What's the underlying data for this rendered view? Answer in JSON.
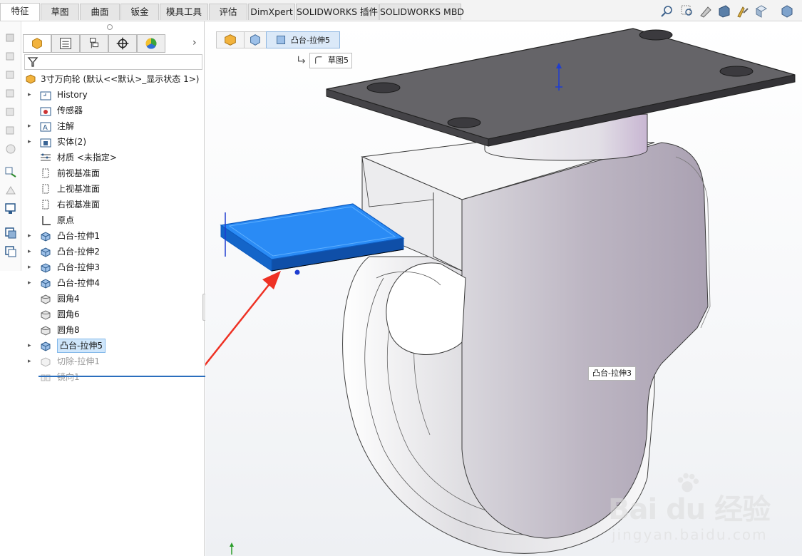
{
  "tabs": [
    {
      "label": "特征",
      "active": true
    },
    {
      "label": "草图"
    },
    {
      "label": "曲面"
    },
    {
      "label": "钣金"
    },
    {
      "label": "模具工具"
    },
    {
      "label": "评估"
    },
    {
      "label": "DimXpert"
    },
    {
      "label": "SOLIDWORKS 插件"
    },
    {
      "label": "SOLIDWORKS MBD"
    }
  ],
  "view_toolbar_icons": [
    "zoom-to-fit-icon",
    "zoom-area-icon",
    "previous-view-icon",
    "section-view-icon",
    "dynamic-annotation-icon",
    "view-orientation-icon",
    "display-style-icon"
  ],
  "side_strip_icons": [
    "extruded-boss-icon",
    "revolved-boss-icon",
    "swept-boss-icon",
    "lofted-boss-icon",
    "boundary-boss-icon",
    "extruded-cut-icon",
    "fillet-icon",
    "linear-pattern-icon",
    "rib-icon",
    "reference-geometry-icon",
    "curves-icon"
  ],
  "feature_manager": {
    "panel_tabs": [
      "feature-tree-icon",
      "property-manager-icon",
      "configuration-manager-icon",
      "dimxpert-manager-icon",
      "display-manager-icon"
    ],
    "root_label": "3寸万向轮 (默认<<默认>_显示状态 1>)",
    "items": [
      {
        "label": "History",
        "icon": "history-folder-icon",
        "expandable": true
      },
      {
        "label": "传感器",
        "icon": "sensors-folder-icon",
        "expandable": false
      },
      {
        "label": "注解",
        "icon": "annotations-folder-icon",
        "expandable": true
      },
      {
        "label": "实体(2)",
        "icon": "solid-bodies-folder-icon",
        "expandable": true
      },
      {
        "label": "材质 <未指定>",
        "icon": "material-icon",
        "expandable": false
      },
      {
        "label": "前视基准面",
        "icon": "plane-icon",
        "expandable": false
      },
      {
        "label": "上视基准面",
        "icon": "plane-icon",
        "expandable": false
      },
      {
        "label": "右视基准面",
        "icon": "plane-icon",
        "expandable": false
      },
      {
        "label": "原点",
        "icon": "origin-icon",
        "expandable": false
      },
      {
        "label": "凸台-拉伸1",
        "icon": "boss-extrude-icon",
        "expandable": true
      },
      {
        "label": "凸台-拉伸2",
        "icon": "boss-extrude-icon",
        "expandable": true
      },
      {
        "label": "凸台-拉伸3",
        "icon": "boss-extrude-icon",
        "expandable": true
      },
      {
        "label": "凸台-拉伸4",
        "icon": "boss-extrude-icon",
        "expandable": true
      },
      {
        "label": "圆角4",
        "icon": "fillet-feature-icon",
        "expandable": false
      },
      {
        "label": "圆角6",
        "icon": "fillet-feature-icon",
        "expandable": false
      },
      {
        "label": "圆角8",
        "icon": "fillet-feature-icon",
        "expandable": false
      },
      {
        "label": "凸台-拉伸5",
        "icon": "boss-extrude-icon",
        "expandable": true,
        "selected": true
      },
      {
        "label": "切除-拉伸1",
        "icon": "cut-extrude-icon",
        "expandable": true,
        "suppressed": true
      },
      {
        "label": "镜向1",
        "icon": "mirror-icon",
        "expandable": false,
        "suppressed": true
      }
    ]
  },
  "viewport": {
    "breadcrumb_label": "凸台-拉伸5",
    "sketch_label": "草图5",
    "tooltip": "凸台-拉伸3",
    "accent_color": "#1e7ef0",
    "arrow_color": "#ee3124"
  },
  "watermark": {
    "brand": "Bai  du 经验",
    "url": "jingyan.baidu.com"
  }
}
